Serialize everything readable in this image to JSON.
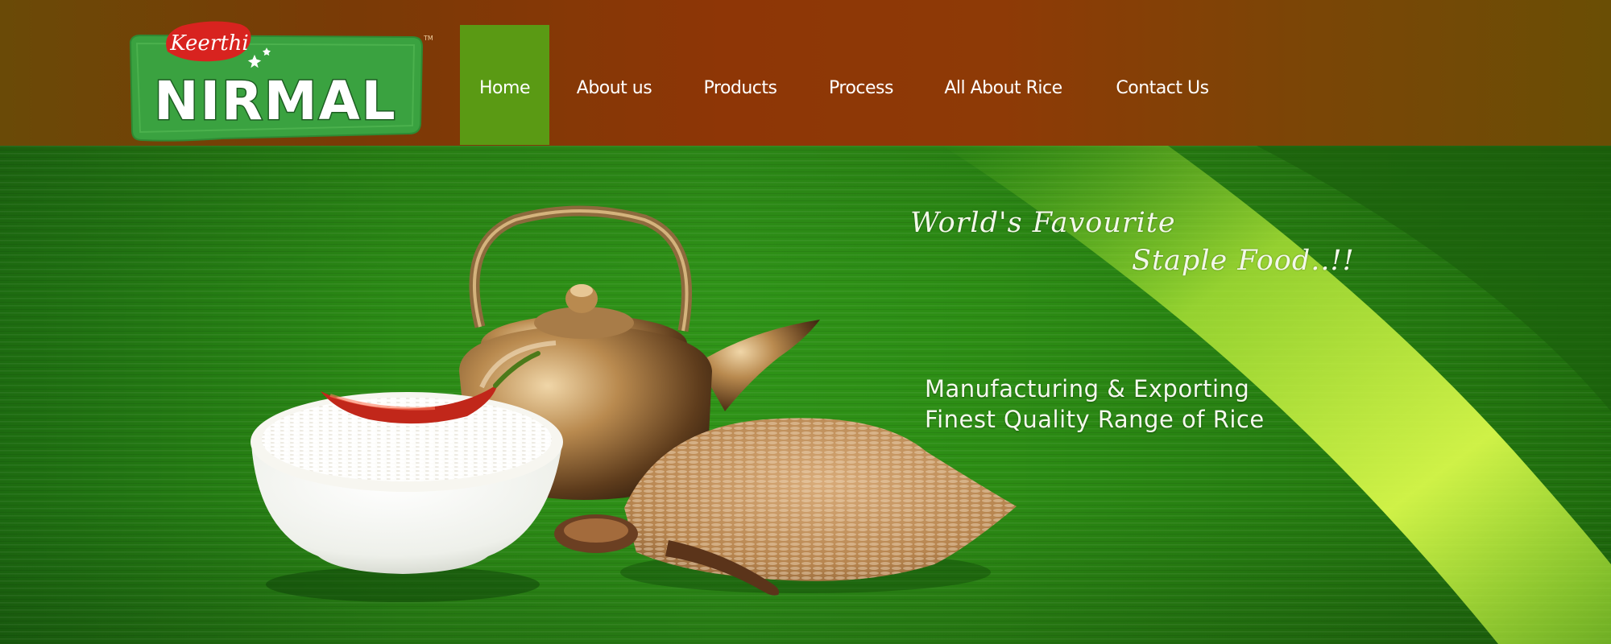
{
  "brand": {
    "logo_top_text": "Keerthi",
    "logo_main_text": "NIRMAL",
    "trademark": "TM",
    "colors": {
      "logo_green": "#3aa240",
      "logo_red": "#d8231f"
    }
  },
  "nav": {
    "items": [
      {
        "label": "Home",
        "active": true
      },
      {
        "label": "About us",
        "active": false
      },
      {
        "label": "Products",
        "active": false
      },
      {
        "label": "Process",
        "active": false
      },
      {
        "label": "All About Rice",
        "active": false
      },
      {
        "label": "Contact Us",
        "active": false
      }
    ],
    "colors": {
      "header_bg": "#8e3606",
      "active_bg": "#5a9a14"
    }
  },
  "hero": {
    "tagline_line1": "World's Favourite",
    "tagline_line2": "Staple Food..!!",
    "headline_line1": "Manufacturing & Exporting",
    "headline_line2": "Finest Quality Range of Rice",
    "image_subjects": [
      "banana-leaf",
      "brass-kettle",
      "white-rice-bowl",
      "red-chilli",
      "brown-rice-heap",
      "wooden-spoon"
    ],
    "colors": {
      "leaf_green": "#2f9318",
      "highlight": "#c9f23a"
    }
  }
}
